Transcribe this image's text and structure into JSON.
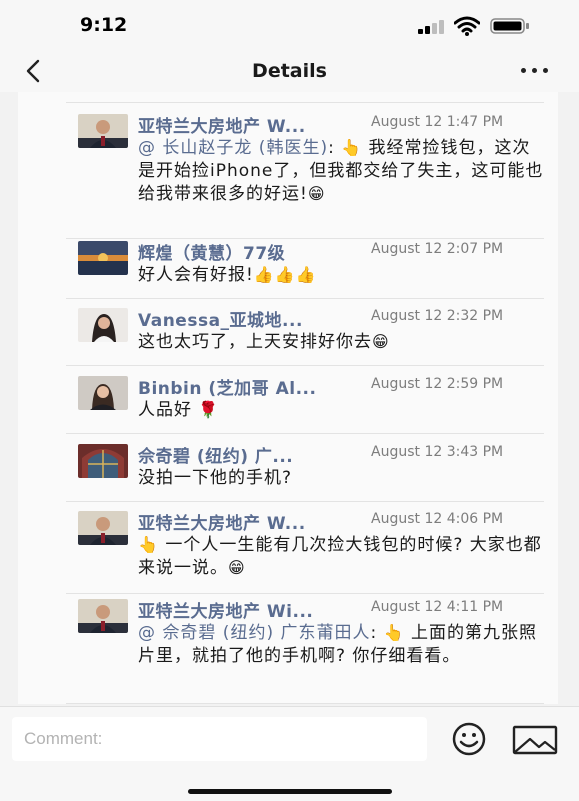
{
  "status_bar": {
    "time": "9:12"
  },
  "nav": {
    "title": "Details"
  },
  "comments": [
    {
      "name": "亚特兰大房地产 W...",
      "time": "August 12 1:47 PM",
      "mention": "@ 长山赵子龙 (韩医生)",
      "text_before": ":",
      "text": "我经常捡钱包，这次是开始捡iPhone了，但我都交给了失主，这可能也给我带来很多的好运!",
      "emoji_lead": "👆",
      "emoji_trail": "😁"
    },
    {
      "name": "辉煌（黄慧）77级",
      "time": "August 12 2:07 PM",
      "text": "好人会有好报!",
      "emoji_trail": "👍👍👍"
    },
    {
      "name": "Vanessa_亚城地...",
      "time": "August 12 2:32 PM",
      "text": "这也太巧了，上天安排好你去",
      "emoji_trail": "😁"
    },
    {
      "name": "Binbin (芝加哥 Al...",
      "time": "August 12 2:59 PM",
      "text": "人品好",
      "emoji_trail": "🌹"
    },
    {
      "name": "佘奇碧 (纽约) 广...",
      "time": "August 12 3:43 PM",
      "text": "没拍一下他的手机?"
    },
    {
      "name": "亚特兰大房地产 W...",
      "time": "August 12 4:06 PM",
      "emoji_lead": "👆",
      "text": "一个人一生能有几次捡大钱包的时候? 大家也都来说一说。",
      "emoji_trail": "😁"
    },
    {
      "name": "亚特兰大房地产 Wi...",
      "time": "August 12 4:11 PM",
      "mention": "@ 佘奇碧 (纽约) 广东莆田人",
      "text_before": ":",
      "emoji_lead": "👆",
      "text": "上面的第九张照片里，就拍了他的手机啊? 你仔细看看。"
    }
  ],
  "composer": {
    "placeholder": "Comment:"
  },
  "icons": {
    "back": "chevron-left-icon",
    "more": "more-dots-icon",
    "emoji": "smiley-icon",
    "image": "image-icon"
  },
  "colors": {
    "name_link": "#5a6c90",
    "time": "#7d7d7d",
    "background": "#f2f2f2"
  }
}
